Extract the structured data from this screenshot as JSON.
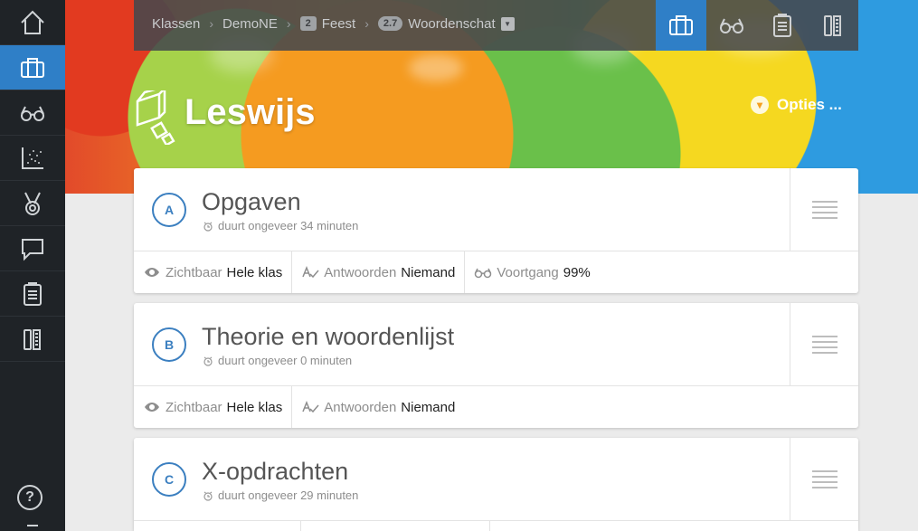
{
  "sidebar": {
    "items": [
      {
        "icon": "home-icon"
      },
      {
        "icon": "briefcase-icon",
        "active": true
      },
      {
        "icon": "glasses-icon"
      },
      {
        "icon": "scatter-chart-icon"
      },
      {
        "icon": "medal-icon"
      },
      {
        "icon": "chat-icon"
      },
      {
        "icon": "clipboard-icon"
      },
      {
        "icon": "ruler-pencil-icon"
      }
    ],
    "help_label": "?"
  },
  "breadcrumb": {
    "root": "Klassen",
    "class": "DemoNE",
    "chapter_badge": "2",
    "chapter": "Feest",
    "section_badge": "2.7",
    "section": "Woordenschat"
  },
  "page": {
    "title": "Leswijs",
    "options_label": "Opties ..."
  },
  "colors": {
    "accent": "#2f7fc7",
    "sidebar_bg": "#1f2327",
    "letter_blue": "#3b7fc0"
  },
  "cards": [
    {
      "letter": "A",
      "title": "Opgaven",
      "duration": "duurt ongeveer 34 minuten",
      "visible_label": "Zichtbaar",
      "visible_value": "Hele klas",
      "answers_label": "Antwoorden",
      "answers_value": "Niemand",
      "progress_label": "Voortgang",
      "progress_value": "99%"
    },
    {
      "letter": "B",
      "title": "Theorie en woordenlijst",
      "duration": "duurt ongeveer 0 minuten",
      "visible_label": "Zichtbaar",
      "visible_value": "Hele klas",
      "answers_label": "Antwoorden",
      "answers_value": "Niemand"
    },
    {
      "letter": "C",
      "title": "X-opdrachten",
      "duration": "duurt ongeveer 29 minuten"
    }
  ]
}
